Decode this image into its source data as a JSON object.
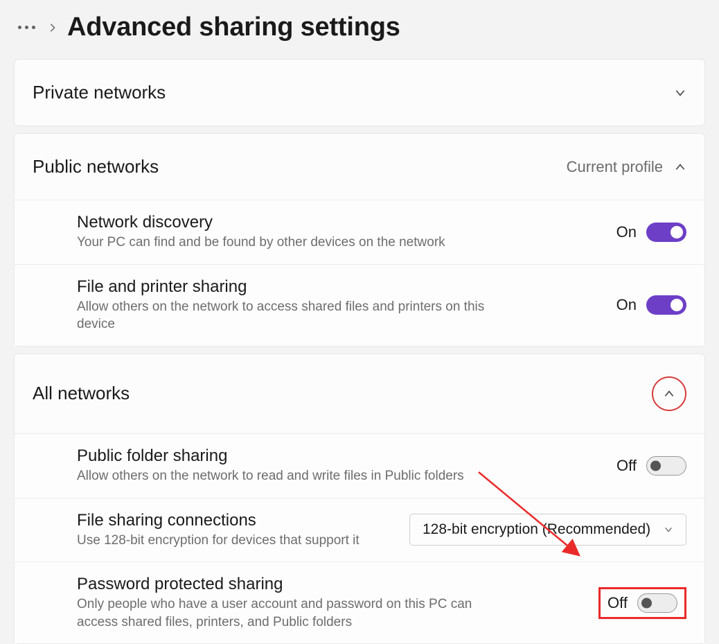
{
  "header": {
    "title": "Advanced sharing settings"
  },
  "sections": {
    "private": {
      "title": "Private networks"
    },
    "public": {
      "title": "Public networks",
      "tag": "Current profile",
      "network_discovery": {
        "title": "Network discovery",
        "desc": "Your PC can find and be found by other devices on the network",
        "state": "On",
        "on": true
      },
      "file_printer": {
        "title": "File and printer sharing",
        "desc": "Allow others on the network to access shared files and printers on this device",
        "state": "On",
        "on": true
      }
    },
    "all": {
      "title": "All networks",
      "public_folder": {
        "title": "Public folder sharing",
        "desc": "Allow others on the network to read and write files in Public folders",
        "state": "Off",
        "on": false
      },
      "connections": {
        "title": "File sharing connections",
        "desc": "Use 128-bit encryption for devices that support it",
        "selected": "128-bit encryption (Recommended)"
      },
      "password": {
        "title": "Password protected sharing",
        "desc": "Only people who have a user account and password on this PC can access shared files, printers, and Public folders",
        "state": "Off",
        "on": false
      }
    }
  }
}
